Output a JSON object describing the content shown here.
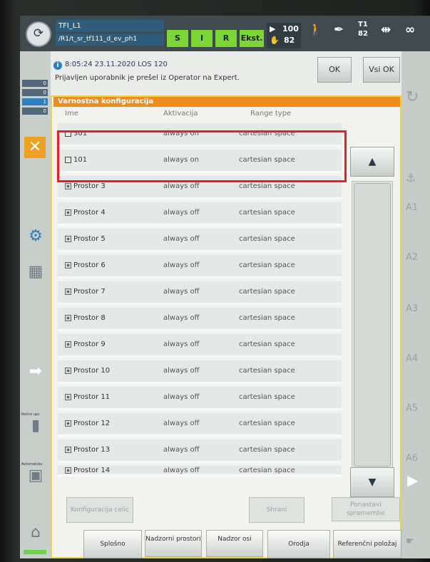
{
  "topbar": {
    "robot_name": "TFI_L1",
    "program_name": "/R1/t_sr_tf111_d_ev_ph1",
    "status_buttons": [
      "S",
      "I",
      "R",
      "Ekst."
    ],
    "override": "100",
    "increment": "82",
    "tool_line1": "T1",
    "tool_line2": "82",
    "infinity": "∞"
  },
  "left_rail": {
    "mini_rows": [
      "0",
      "0",
      "1",
      "0"
    ],
    "label_a": "Ročno upr.",
    "label_b": "Avtomatsko"
  },
  "message": {
    "time": "8:05:24 23.11.2020 LOS 120",
    "text": "Prijavljen uporabnik je prešel iz Operator na Expert.",
    "ok_label": "OK",
    "all_ok_label": "Vsi OK"
  },
  "panel": {
    "title": "Varnostna konfiguracija",
    "columns": [
      "Ime",
      "Aktivacija",
      "Range type"
    ],
    "rows": [
      {
        "name": "301",
        "activation": "always on",
        "range_type": "cartesian space"
      },
      {
        "name": "101",
        "activation": "always on",
        "range_type": "cartesian space"
      },
      {
        "name": "Prostor 3",
        "activation": "always off",
        "range_type": "cartesian space"
      },
      {
        "name": "Prostor 4",
        "activation": "always off",
        "range_type": "cartesian space"
      },
      {
        "name": "Prostor 5",
        "activation": "always off",
        "range_type": "cartesian space"
      },
      {
        "name": "Prostor 6",
        "activation": "always off",
        "range_type": "cartesian space"
      },
      {
        "name": "Prostor 7",
        "activation": "always off",
        "range_type": "cartesian space"
      },
      {
        "name": "Prostor 8",
        "activation": "always off",
        "range_type": "cartesian space"
      },
      {
        "name": "Prostor 9",
        "activation": "always off",
        "range_type": "cartesian space"
      },
      {
        "name": "Prostor 10",
        "activation": "always off",
        "range_type": "cartesian space"
      },
      {
        "name": "Prostor 11",
        "activation": "always off",
        "range_type": "cartesian space"
      },
      {
        "name": "Prostor 12",
        "activation": "always off",
        "range_type": "cartesian space"
      },
      {
        "name": "Prostor 13",
        "activation": "always off",
        "range_type": "cartesian space"
      },
      {
        "name": "Prostor 14",
        "activation": "always off",
        "range_type": "cartesian space"
      }
    ],
    "buttons": {
      "config_label": "Konfiguracija celic",
      "save_label": "Shrani",
      "reset_label": "Ponastavi spremembe"
    },
    "tabs": [
      "Splošno",
      "Nadzorni prostori",
      "Nadzor osi",
      "Orodja",
      "Referenčni položaj"
    ]
  },
  "right_rail": {
    "axes": [
      "A1",
      "A2",
      "A3",
      "A4",
      "A5",
      "A6"
    ]
  }
}
